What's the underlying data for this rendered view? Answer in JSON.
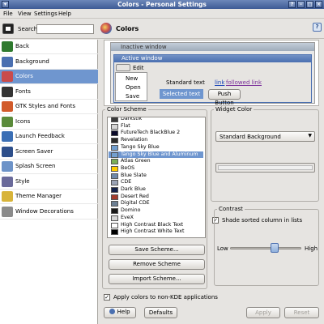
{
  "window": {
    "title": "Colors - Personal Settings"
  },
  "menu": [
    "File",
    "View",
    "Settings",
    "Help"
  ],
  "toolbar": {
    "search_label": "Search:",
    "search_value": ""
  },
  "sidebar": {
    "items": [
      {
        "label": "Back",
        "color": "#2f7a2f"
      },
      {
        "label": "Background",
        "color": "#4a6fb0"
      },
      {
        "label": "Colors",
        "color": "#c94b4b"
      },
      {
        "label": "Fonts",
        "color": "#333333"
      },
      {
        "label": "GTK Styles and Fonts",
        "color": "#d25b2b"
      },
      {
        "label": "Icons",
        "color": "#5a8a3a"
      },
      {
        "label": "Launch Feedback",
        "color": "#3b6fb5"
      },
      {
        "label": "Screen Saver",
        "color": "#2d4e8a"
      },
      {
        "label": "Splash Screen",
        "color": "#6d93c8"
      },
      {
        "label": "Style",
        "color": "#6a6a9a"
      },
      {
        "label": "Theme Manager",
        "color": "#d8b43a"
      },
      {
        "label": "Window Decorations",
        "color": "#8b8b8b"
      }
    ]
  },
  "header": {
    "title": "Colors"
  },
  "preview": {
    "inactive_title": "Inactive window",
    "active_title": "Active window",
    "menu_label": "Edit",
    "popup_items": [
      "New",
      "Open",
      "Save"
    ],
    "standard_text": "Standard text",
    "link": "link",
    "followed_link": "followed link",
    "selected_text": "Selected text",
    "push_button": "Push Button"
  },
  "scheme": {
    "group_label": "Color Scheme",
    "items": [
      {
        "name": "Darkstik",
        "swatch": "#3a3a3a"
      },
      {
        "name": "Flat",
        "swatch": "#d6d6d6"
      },
      {
        "name": "FutureTech BlackBlue 2",
        "swatch": "#0a0a2a"
      },
      {
        "name": "Revelation",
        "swatch": "#2b2b2b"
      },
      {
        "name": "Tango Sky Blue",
        "swatch": "#729fcf"
      },
      {
        "name": "Tango Sky Blue and Aluminum",
        "swatch": "#729fcf",
        "selected": true
      },
      {
        "name": "Atlas Green",
        "swatch": "#7bae58"
      },
      {
        "name": "BeOS",
        "swatch": "#ffcb00"
      },
      {
        "name": "Blue Slate",
        "swatch": "#6f88a8"
      },
      {
        "name": "CDE",
        "swatch": "#9aa3b5"
      },
      {
        "name": "Dark Blue",
        "swatch": "#14224a"
      },
      {
        "name": "Desert Red",
        "swatch": "#a43c2c"
      },
      {
        "name": "Digital CDE",
        "swatch": "#6c7f93"
      },
      {
        "name": "Domino",
        "swatch": "#1a1a1a"
      },
      {
        "name": "EveX",
        "swatch": "#d8d8d8"
      },
      {
        "name": "High Contrast Black Text",
        "swatch": "#ffffff"
      },
      {
        "name": "High Contrast White Text",
        "swatch": "#000000"
      }
    ],
    "save_label": "Save Scheme...",
    "remove_label": "Remove Scheme",
    "import_label": "Import Scheme..."
  },
  "widget_color": {
    "group_label": "Widget Color",
    "selected": "Standard Background",
    "shade_label": "Shade sorted column in lists",
    "shade_checked": true
  },
  "contrast": {
    "group_label": "Contrast",
    "low": "Low",
    "high": "High",
    "level": 0.62
  },
  "apply_label": "Apply colors to non-KDE applications",
  "apply_checked": true,
  "footer": {
    "help": "Help",
    "defaults": "Defaults",
    "apply": "Apply",
    "reset": "Reset"
  },
  "colors": {
    "accent": "#6f96cf",
    "titlebar": "#3e5b95"
  }
}
